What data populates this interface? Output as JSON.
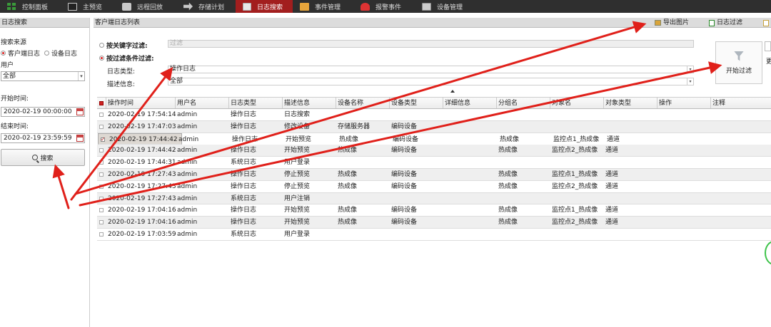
{
  "topbar": {
    "items": [
      {
        "label": "控制面板",
        "icon": "dashboard-icon"
      },
      {
        "label": "主预览",
        "icon": "monitor-icon"
      },
      {
        "label": "远程回放",
        "icon": "playback-icon"
      },
      {
        "label": "存储计划",
        "icon": "storage-icon"
      },
      {
        "label": "日志搜索",
        "icon": "log-icon",
        "active": true
      },
      {
        "label": "事件管理",
        "icon": "folder-icon"
      },
      {
        "label": "报警事件",
        "icon": "alarm-icon"
      },
      {
        "label": "设备管理",
        "icon": "device-icon"
      }
    ]
  },
  "left": {
    "title": "日志搜索",
    "source_label": "搜索来源",
    "radio_client": "客户端日志",
    "radio_device": "设备日志",
    "user_label": "用户",
    "user_value": "全部",
    "start_label": "开始时间:",
    "start_value": "2020-02-19 00:00:00",
    "end_label": "结束时间:",
    "end_value": "2020-02-19 23:59:59",
    "search_label": "搜索"
  },
  "main": {
    "title": "客户端日志列表",
    "export_label": "导出图片",
    "log_filter_label": "日志过滤",
    "keyword_filter_label": "按关键字过滤:",
    "keyword_placeholder": "过滤",
    "condition_filter_label": "按过滤条件过滤:",
    "log_type_label": "日志类型:",
    "log_type_value": "操作日志",
    "desc_label": "描述信息:",
    "desc_value": "全部",
    "start_filter_label": "开始过滤",
    "side_more": "更"
  },
  "table": {
    "columns": [
      "操作时间",
      "用户名",
      "日志类型",
      "描述信息",
      "设备名称",
      "设备类型",
      "详细信息",
      "分组名",
      "对象名",
      "对象类型",
      "操作",
      "注释"
    ],
    "rows": [
      [
        "2020-02-19 17:54:14",
        "admin",
        "操作日志",
        "日志搜索",
        "",
        "",
        "",
        "",
        "",
        "",
        "",
        ""
      ],
      [
        "2020-02-19 17:47:03",
        "admin",
        "操作日志",
        "修改设备",
        "存储服务器",
        "编码设备",
        "",
        "",
        "",
        "",
        "",
        ""
      ],
      [
        "2020-02-19 17:44:42",
        "admin",
        "操作日志",
        "开始预览",
        "热成像",
        "编码设备",
        "",
        "热成像",
        "监控点1_热成像",
        "通道",
        "",
        ""
      ],
      [
        "2020-02-19 17:44:42",
        "admin",
        "操作日志",
        "开始预览",
        "热成像",
        "编码设备",
        "",
        "热成像",
        "监控点2_热成像",
        "通道",
        "",
        ""
      ],
      [
        "2020-02-19 17:44:31",
        "admin",
        "系统日志",
        "用户登录",
        "",
        "",
        "",
        "",
        "",
        "",
        "",
        ""
      ],
      [
        "2020-02-19 17:27:43",
        "admin",
        "操作日志",
        "停止预览",
        "热成像",
        "编码设备",
        "",
        "热成像",
        "监控点1_热成像",
        "通道",
        "",
        ""
      ],
      [
        "2020-02-19 17:27:43",
        "admin",
        "操作日志",
        "停止预览",
        "热成像",
        "编码设备",
        "",
        "热成像",
        "监控点2_热成像",
        "通道",
        "",
        ""
      ],
      [
        "2020-02-19 17:27:43",
        "admin",
        "系统日志",
        "用户注销",
        "",
        "",
        "",
        "",
        "",
        "",
        "",
        ""
      ],
      [
        "2020-02-19 17:04:16",
        "admin",
        "操作日志",
        "开始预览",
        "热成像",
        "编码设备",
        "",
        "热成像",
        "监控点1_热成像",
        "通道",
        "",
        ""
      ],
      [
        "2020-02-19 17:04:16",
        "admin",
        "操作日志",
        "开始预览",
        "热成像",
        "编码设备",
        "",
        "热成像",
        "监控点2_热成像",
        "通道",
        "",
        ""
      ],
      [
        "2020-02-19 17:03:59",
        "admin",
        "系统日志",
        "用户登录",
        "",
        "",
        "",
        "",
        "",
        "",
        "",
        ""
      ]
    ],
    "checked_row": 2
  },
  "colors": {
    "topbar_bg": "#2f2f2f",
    "active_tab": "#a21e1e",
    "annotation_arrow": "#e0201a"
  }
}
